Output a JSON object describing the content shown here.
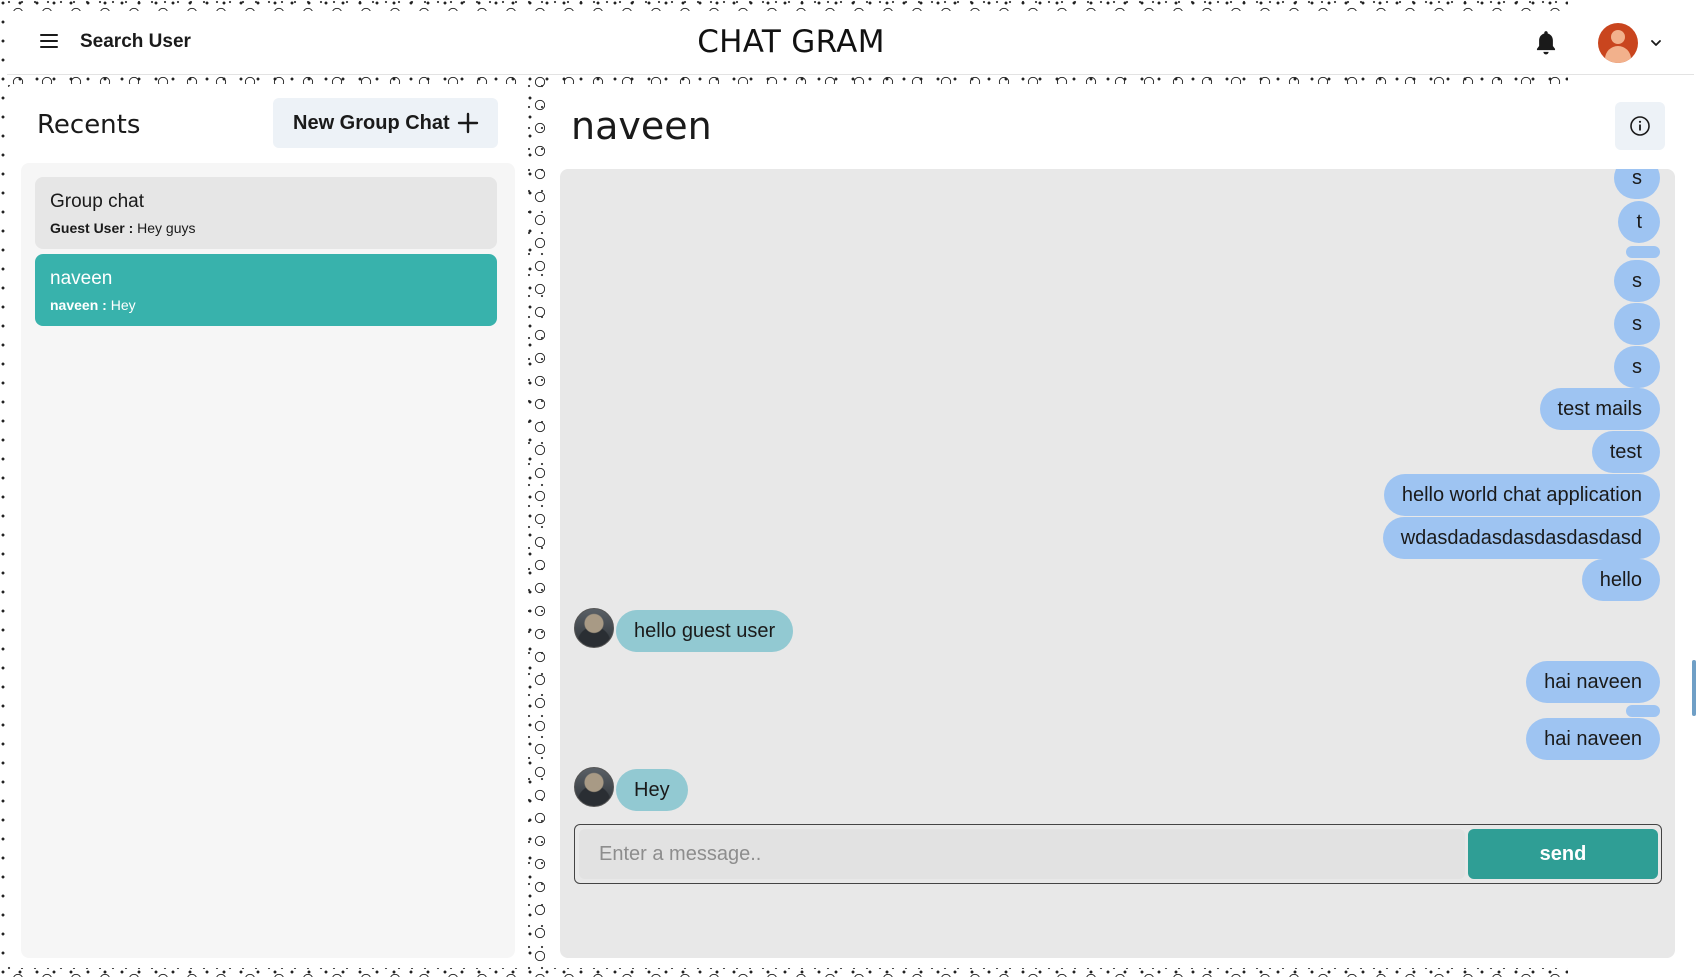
{
  "header": {
    "search_label": "Search User",
    "app_title": "CHAT GRAM",
    "menu_icon": "hamburger-menu-icon",
    "bell_icon": "bell-icon",
    "chevron_icon": "chevron-down-icon"
  },
  "sidebar": {
    "title": "Recents",
    "new_group_label": "New Group Chat",
    "chats": [
      {
        "name": "Group chat",
        "sender": "Guest User :",
        "message": "Hey guys",
        "active": false
      },
      {
        "name": "naveen",
        "sender": "naveen :",
        "message": "Hey",
        "active": true
      }
    ]
  },
  "chat": {
    "title": "naveen",
    "info_icon": "info-icon",
    "messages": [
      {
        "text": "s",
        "from": "me"
      },
      {
        "text": "t",
        "from": "me"
      },
      {
        "text": "",
        "from": "me"
      },
      {
        "text": "s",
        "from": "me"
      },
      {
        "text": "s",
        "from": "me"
      },
      {
        "text": "s",
        "from": "me"
      },
      {
        "text": "test mails",
        "from": "me"
      },
      {
        "text": "test",
        "from": "me"
      },
      {
        "text": "hello world chat application",
        "from": "me"
      },
      {
        "text": "wdasdadasdasdasdasdasd",
        "from": "me"
      },
      {
        "text": "hello",
        "from": "me"
      },
      {
        "text": "hello guest user",
        "from": "naveen"
      },
      {
        "text": "hai naveen",
        "from": "me"
      },
      {
        "text": "",
        "from": "me"
      },
      {
        "text": "hai naveen",
        "from": "me"
      },
      {
        "text": "Hey",
        "from": "naveen"
      }
    ],
    "input_placeholder": "Enter a message..",
    "input_value": "",
    "send_label": "send"
  },
  "colors": {
    "accent": "#38b2ac",
    "send_button": "#2f9e95",
    "sent_bubble": "#9ec4f2",
    "received_bubble": "#92c9d2"
  }
}
